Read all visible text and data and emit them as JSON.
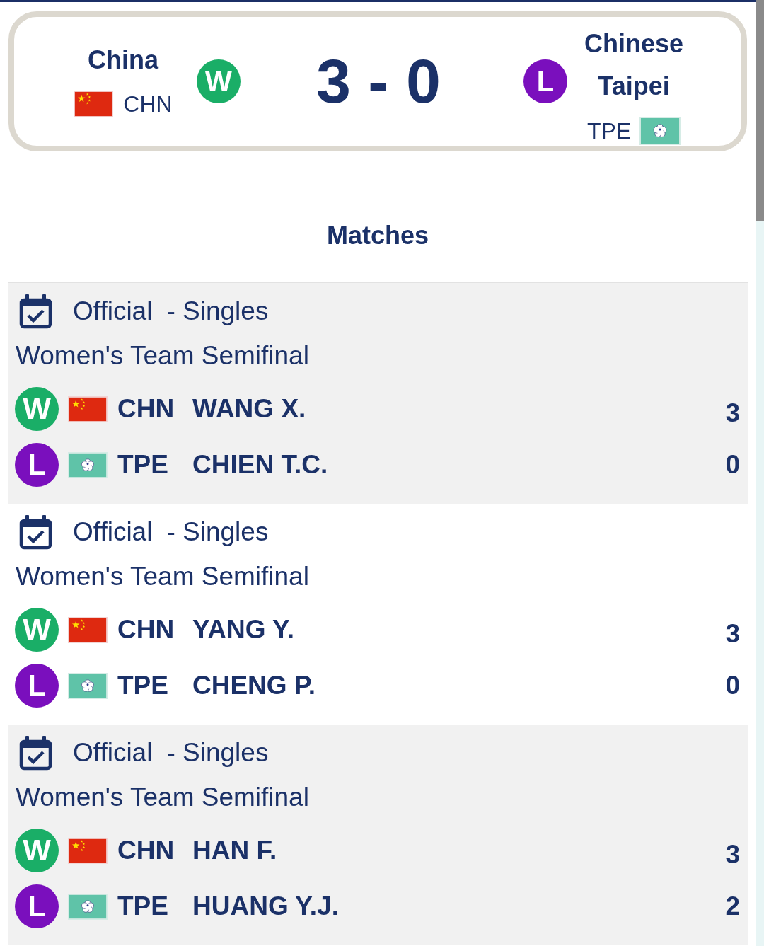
{
  "scoreboard": {
    "home": {
      "name": "China",
      "code": "CHN",
      "kind": "china",
      "result": "W",
      "color": "#1aae67"
    },
    "score": "3 - 0",
    "away": {
      "name": "Chinese Taipei",
      "code": "TPE",
      "kind": "taipei",
      "result": "L",
      "color": "#7a0fbd"
    }
  },
  "section_title": "Matches",
  "matches": [
    {
      "status": "Official",
      "type": "- Singles",
      "event": "Women's Team Semifinal",
      "players": [
        {
          "result": "W",
          "color": "#1aae67",
          "kind": "china",
          "code": "CHN",
          "name": "WANG X.",
          "score": "3"
        },
        {
          "result": "L",
          "color": "#7a0fbd",
          "kind": "taipei",
          "code": "TPE",
          "name": "CHIEN T.C.",
          "score": "0"
        }
      ]
    },
    {
      "status": "Official",
      "type": "- Singles",
      "event": "Women's Team Semifinal",
      "players": [
        {
          "result": "W",
          "color": "#1aae67",
          "kind": "china",
          "code": "CHN",
          "name": "YANG Y.",
          "score": "3"
        },
        {
          "result": "L",
          "color": "#7a0fbd",
          "kind": "taipei",
          "code": "TPE",
          "name": "CHENG P.",
          "score": "0"
        }
      ]
    },
    {
      "status": "Official",
      "type": "- Singles",
      "event": "Women's Team Semifinal",
      "players": [
        {
          "result": "W",
          "color": "#1aae67",
          "kind": "china",
          "code": "CHN",
          "name": "HAN F.",
          "score": "3"
        },
        {
          "result": "L",
          "color": "#7a0fbd",
          "kind": "taipei",
          "code": "TPE",
          "name": "HUANG Y.J.",
          "score": "2"
        }
      ]
    }
  ]
}
